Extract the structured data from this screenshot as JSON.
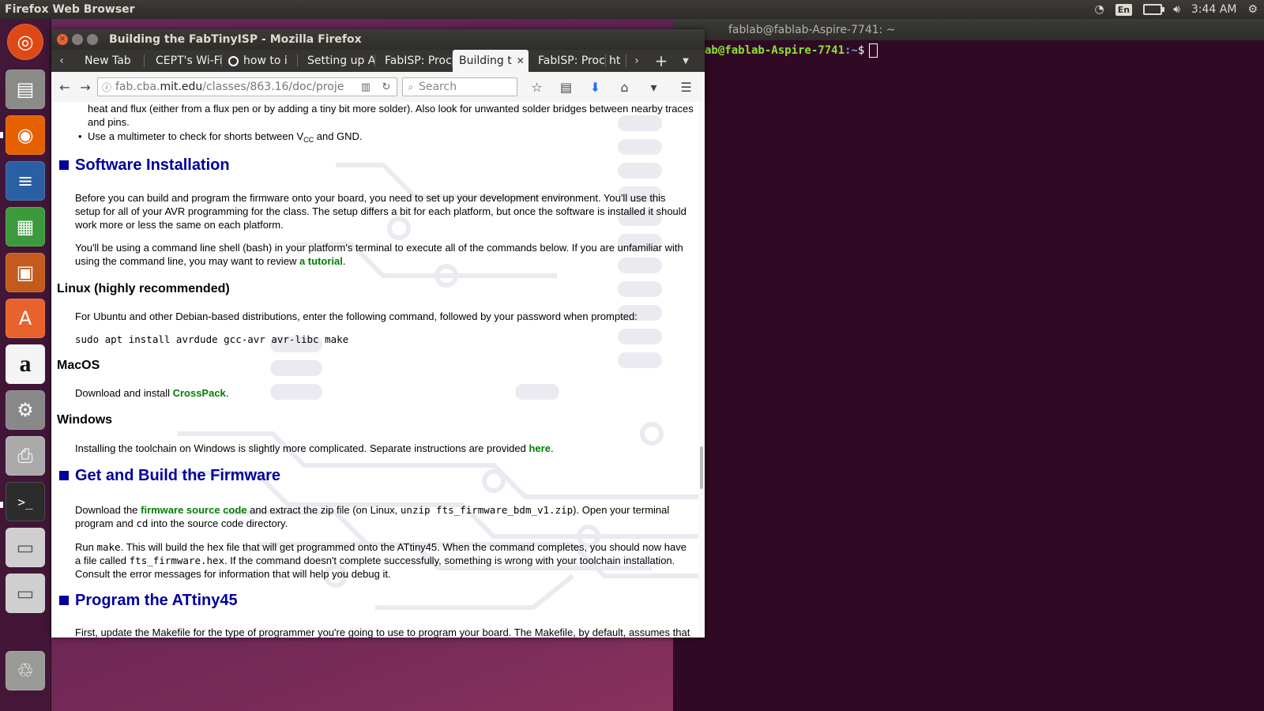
{
  "top_panel": {
    "app_title": "Firefox Web Browser",
    "lang": "En",
    "time": "3:44 AM"
  },
  "launcher": {
    "icons": [
      "ubuntu-logo-icon",
      "files-icon",
      "firefox-icon",
      "writer-icon",
      "calc-icon",
      "impress-icon",
      "software-center-icon",
      "amazon-icon",
      "system-settings-icon",
      "printer-icon",
      "terminal-icon",
      "disk-icon",
      "disk-icon",
      "trash-icon"
    ]
  },
  "terminal": {
    "title": "fablab@fablab-Aspire-7741: ~",
    "prompt_user": "ab@fablab-Aspire-7741",
    "prompt_path": ":~",
    "prompt_symbol": "$"
  },
  "firefox": {
    "window_title": "Building the FabTinyISP - Mozilla Firefox",
    "tabs": [
      {
        "label": "New Tab"
      },
      {
        "label": "CEPT's Wi-Fi"
      },
      {
        "label": "how to i"
      },
      {
        "label": "Setting up A"
      },
      {
        "label": "FabISP: Proc"
      },
      {
        "label": "Building t"
      },
      {
        "label": "FabISP: Proc"
      },
      {
        "label": "ht"
      }
    ],
    "url_host_pre": "fab.cba.",
    "url_host": "mit.edu",
    "url_path": "/classes/863.16/doc/proje",
    "search_placeholder": "Search"
  },
  "page": {
    "intro_line1": "heat and flux (either from a flux pen or by adding a tiny bit more solder). Also look for unwanted solder bridges between nearby traces",
    "intro_line2": "and pins.",
    "bullet_pre": "Use a multimeter to check for shorts between V",
    "bullet_sub": "CC",
    "bullet_post": " and GND.",
    "h_software": "Software Installation",
    "p_software": "Before you can build and program the firmware onto your board, you need to set up your development environment. You'll use this setup for all of your AVR programming for the class. The setup differs a bit for each platform, but once the software is installed it should work more or less the same on each platform.",
    "p_shell_pre": "You'll be using a command line shell (bash) in your platform's terminal to execute all of the commands below. If you are unfamiliar with using the command line, you may want to review ",
    "p_shell_link": "a tutorial",
    "p_shell_post": ".",
    "h_linux": "Linux (highly recommended)",
    "p_linux": "For Ubuntu and other Debian-based distributions, enter the following command, followed by your password when prompted:",
    "code_linux": "sudo apt install avrdude gcc-avr avr-libc make",
    "h_mac": "MacOS",
    "p_mac_pre": "Download and install ",
    "p_mac_link": "CrossPack",
    "p_mac_post": ".",
    "h_windows": "Windows",
    "p_win_pre": "Installing the toolchain on Windows is slightly more complicated. Separate instructions are provided ",
    "p_win_link": "here",
    "p_win_post": ".",
    "h_firmware": "Get and Build the Firmware",
    "p_fw_pre": "Download the ",
    "p_fw_link": "firmware source code",
    "p_fw_mid": " and extract the zip file (on Linux, ",
    "p_fw_code1": "unzip fts_firmware_bdm_v1.zip",
    "p_fw_mid2": "). Open your terminal program and ",
    "p_fw_code2": "cd",
    "p_fw_post": " into the source code directory.",
    "p_make_pre": "Run ",
    "p_make_code": "make",
    "p_make_mid": ". This will build the hex file that will get programmed onto the ATtiny45. When the command completes, you should now have a file called ",
    "p_make_code2": "fts_firmware.hex",
    "p_make_post": ". If the command doesn't complete successfully, something is wrong with your toolchain installation. Consult the error messages for information that will help you debug it.",
    "h_program": "Program the ATtiny45",
    "p_program": "First, update the Makefile for the type of programmer you're going to use to program your board. The Makefile, by default, assumes that"
  }
}
